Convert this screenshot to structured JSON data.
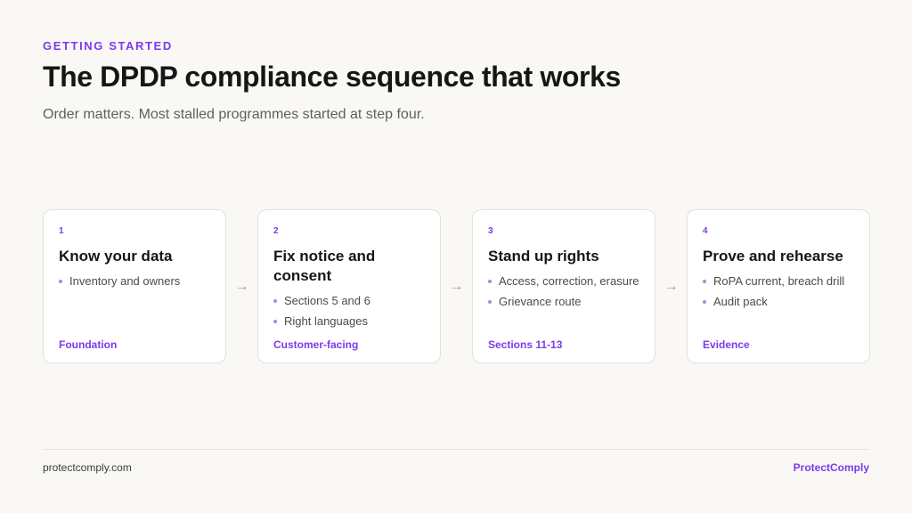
{
  "header": {
    "eyebrow": "GETTING STARTED",
    "title": "The DPDP compliance sequence that works",
    "subtitle": "Order matters. Most stalled programmes started at step four."
  },
  "steps": [
    {
      "number": "1",
      "title": "Know your data",
      "bullets": [
        "Inventory and owners"
      ],
      "tag": "Foundation"
    },
    {
      "number": "2",
      "title": "Fix notice and consent",
      "bullets": [
        "Sections 5 and 6",
        "Right languages"
      ],
      "tag": "Customer-facing"
    },
    {
      "number": "3",
      "title": "Stand up rights",
      "bullets": [
        "Access, correction, erasure",
        "Grievance route"
      ],
      "tag": "Sections 11-13"
    },
    {
      "number": "4",
      "title": "Prove and rehearse",
      "bullets": [
        "RoPA current, breach drill",
        "Audit pack"
      ],
      "tag": "Evidence"
    }
  ],
  "arrow_glyph": "→",
  "footer": {
    "site": "protectcomply.com",
    "brand": "ProtectComply"
  },
  "colors": {
    "accent": "#7c3aed",
    "background": "#f9f8f5",
    "card": "#ffffff"
  }
}
